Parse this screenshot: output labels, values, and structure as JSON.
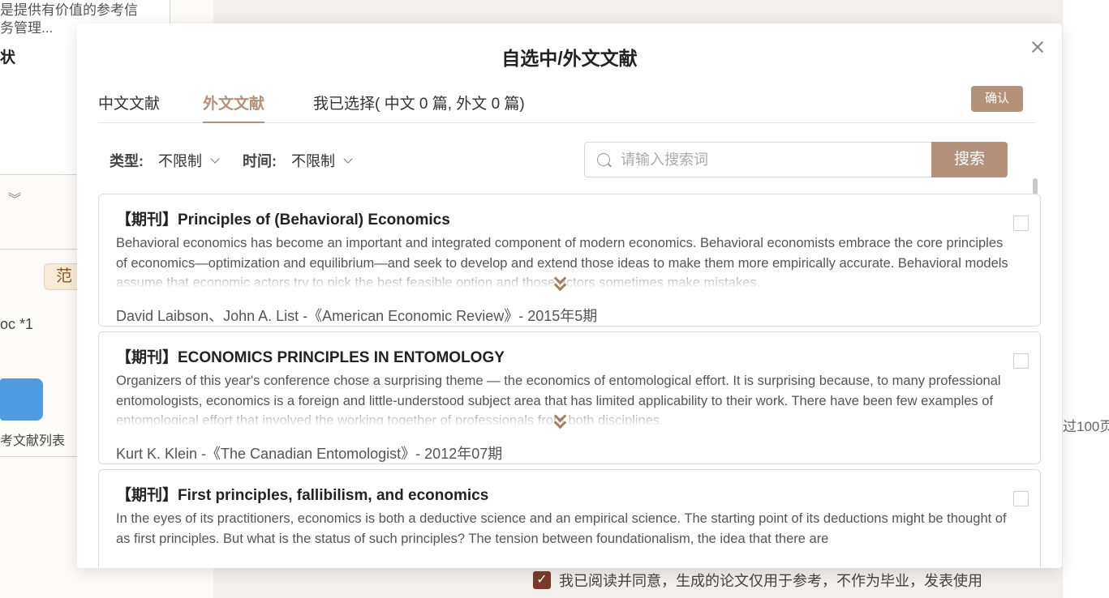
{
  "background": {
    "left_text_1": "是提供有价值的参考信",
    "left_text_2": "务管理...",
    "left_bold": "状",
    "left_tag": "范",
    "left_doc": "oc *1",
    "folder_label": "考文献列表",
    "right_text": "过100页",
    "agree_text": "我已阅读并同意，生成的论文仅用于参考，不作为毕业，发表使用"
  },
  "modal": {
    "title": "自选中/外文文献",
    "tabs": [
      {
        "label": "中文文献",
        "active": false
      },
      {
        "label": "外文文献",
        "active": true
      },
      {
        "label": "我已选择( 中文 0 篇, 外文 0 篇)",
        "active": false
      }
    ],
    "confirm_label": "确认",
    "filters": {
      "type_label": "类型:",
      "type_value": "不限制",
      "time_label": "时间:",
      "time_value": "不限制"
    },
    "search": {
      "placeholder": "请输入搜索词",
      "value": "",
      "button_label": "搜索"
    },
    "accent_color": "#b3917a",
    "results": [
      {
        "title": "【期刊】Principles of (Behavioral) Economics",
        "abstract": "Behavioral economics has become an important and integrated component of modern economics. Behavioral economists embrace the core principles of economics—optimization and equilibrium—and seek to develop and extend those ideas to make them more empirically accurate. Behavioral models assume that economic actors try to pick the best feasible option and those actors sometimes make mistakes.",
        "meta": "David Laibson、John A. List -《American Economic Review》- 2015年5期",
        "checked": false
      },
      {
        "title": "【期刊】ECONOMICS PRINCIPLES IN ENTOMOLOGY",
        "abstract": "Organizers of this year's conference chose a surprising theme — the economics of entomological effort. It is surprising because, to many professional entomologists, economics is a foreign and little-understood subject area that has limited applicability to their work. There have been few examples of entomological effort that involved the working together of professionals from both disciplines.",
        "meta": "Kurt K. Klein -《The Canadian Entomologist》- 2012年07期",
        "checked": false
      },
      {
        "title": "【期刊】First principles, fallibilism, and economics",
        "abstract": "In the eyes of its practitioners, economics is both a deductive science and an empirical science. The starting point of its deductions might be thought of as first principles. But what is the status of such principles? The tension between foundationalism, the idea that there are",
        "meta": "",
        "checked": false
      }
    ]
  }
}
